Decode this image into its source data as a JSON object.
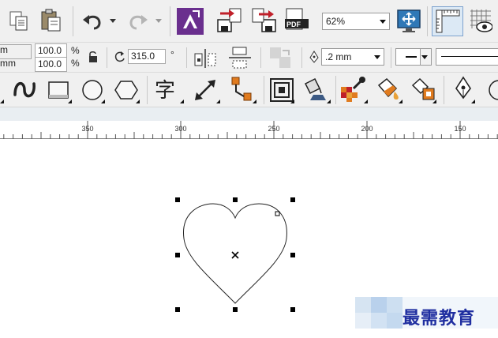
{
  "standard_toolbar": {
    "zoom_level": "62%",
    "buttons": [
      "copy",
      "paste",
      "undo",
      "redo",
      "import",
      "export",
      "export-pdf",
      "full-screen-preview",
      "show-rulers",
      "show-grid",
      "view"
    ]
  },
  "property_bar": {
    "unit_prefix_1": "m",
    "unit_prefix_2": "mm",
    "scale_x": "100.0",
    "scale_y": "100.0",
    "percent_1": "%",
    "percent_2": "%",
    "rotation_angle": "315.0",
    "degree_sign": "°",
    "outline_width": ".2 mm"
  },
  "ruler": {
    "labels": [
      "350",
      "300",
      "250",
      "200",
      "150"
    ]
  },
  "watermark": {
    "text": "最需教育"
  },
  "colors": {
    "toolbar_bg": "#f0f0f0",
    "ruler_band": "#e9eef2",
    "accent_purple": "#6a2f8e",
    "icon_red": "#c0202a",
    "icon_orange": "#e07b1f",
    "watermark_blue": "#1f2ea0"
  }
}
